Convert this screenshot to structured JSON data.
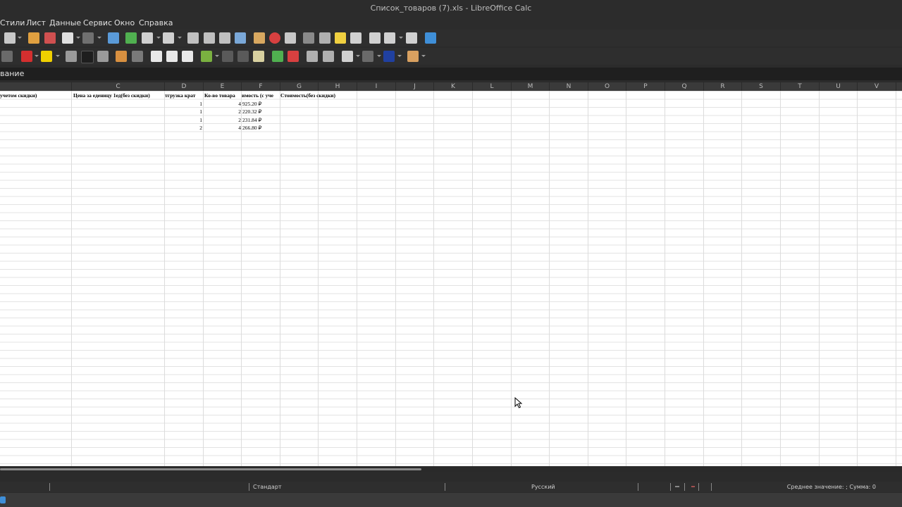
{
  "window": {
    "title": "Список_товаров (7).xls - LibreOffice Calc"
  },
  "menu": {
    "items": [
      "Стили",
      "Лист",
      "Данные",
      "Сервис",
      "Окно",
      "Справка"
    ]
  },
  "formula_bar": {
    "content": "вание"
  },
  "columns": [
    "C",
    "D",
    "E",
    "F",
    "G",
    "H",
    "I",
    "J",
    "K",
    "L",
    "M",
    "N",
    "O",
    "P",
    "Q",
    "R",
    "S",
    "T",
    "U",
    "V"
  ],
  "sheet": {
    "headers": {
      "b": "учетом скидки)",
      "c": "Цена за еденицу 1ед(без скидки)",
      "d": "тгрузка крат",
      "e": "Ко-во товара",
      "f": "имость (с уче",
      "g": "Стоимость(без скидки)"
    },
    "rows": [
      {
        "d": "1",
        "e": "4",
        "f": "925.20 ₽"
      },
      {
        "d": "1",
        "e": "2",
        "f": "220.32 ₽"
      },
      {
        "d": "1",
        "e": "2",
        "f": "231.84 ₽"
      },
      {
        "d": "2",
        "e": "4",
        "f": "266.80 ₽"
      }
    ]
  },
  "status": {
    "page_style": "Стандарт",
    "language": "Русский",
    "summary": "Среднее значение: ; Сумма: 0"
  },
  "colors": {
    "accent_red": "#d32f2f",
    "accent_yellow": "#f0d000",
    "accent_blue": "#3f8fd8"
  }
}
